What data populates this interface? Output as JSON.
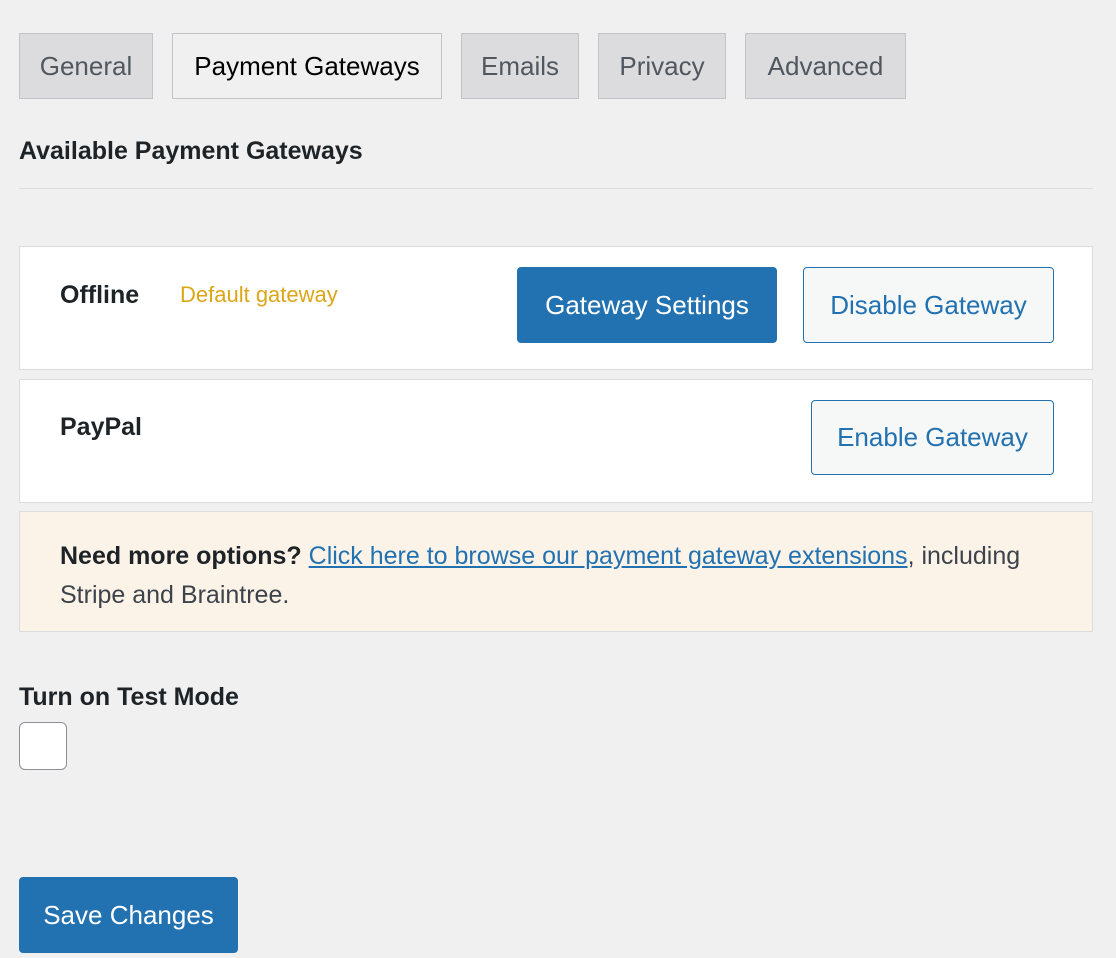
{
  "tabs": [
    {
      "label": "General",
      "active": false
    },
    {
      "label": "Payment Gateways",
      "active": true
    },
    {
      "label": "Emails",
      "active": false
    },
    {
      "label": "Privacy",
      "active": false
    },
    {
      "label": "Advanced",
      "active": false
    }
  ],
  "section_title": "Available Payment Gateways",
  "gateways": [
    {
      "name": "Offline",
      "default_label": "Default gateway",
      "actions": {
        "settings": "Gateway Settings",
        "disable": "Disable Gateway"
      }
    },
    {
      "name": "PayPal",
      "actions": {
        "enable": "Enable Gateway"
      }
    }
  ],
  "notice": {
    "lead": "Need more options?",
    "link_text": "Click here to browse our payment gateway extensions",
    "trail": ", including Stripe and Braintree."
  },
  "test_mode": {
    "label": "Turn on Test Mode",
    "checked": false
  },
  "save_button": "Save Changes",
  "colors": {
    "primary": "#2271b1",
    "default_gateway": "#dba617",
    "notice_bg": "#fcf3e8",
    "page_bg": "#f0f0f1"
  }
}
